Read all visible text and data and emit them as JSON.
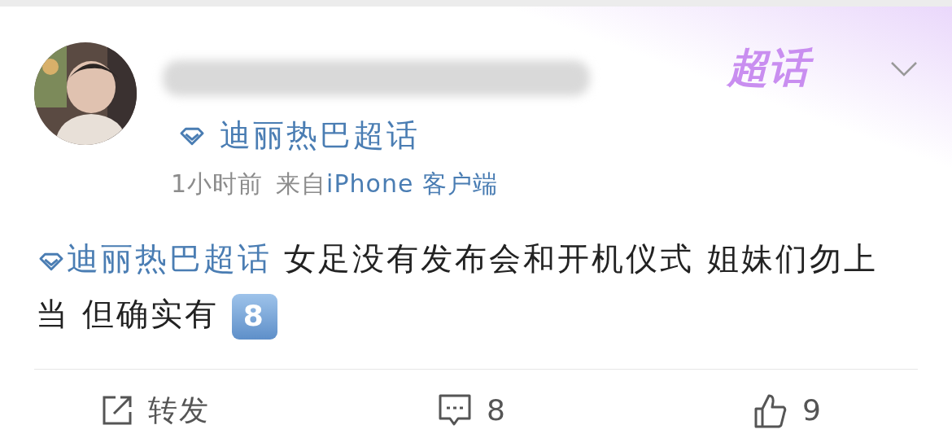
{
  "header": {
    "badge": "超话",
    "topic": "迪丽热巴超话",
    "time": "1小时前",
    "source_prefix": "来自",
    "source": "iPhone 客户端"
  },
  "post": {
    "topic_link": "迪丽热巴超话",
    "text": " 女足没有发布会和开机仪式 姐妹们勿上当 但确实有 ",
    "emoji": "8"
  },
  "actions": [
    {
      "kind": "repost",
      "label": "转发"
    },
    {
      "kind": "comment",
      "label": "8"
    },
    {
      "kind": "like",
      "label": "9"
    }
  ]
}
